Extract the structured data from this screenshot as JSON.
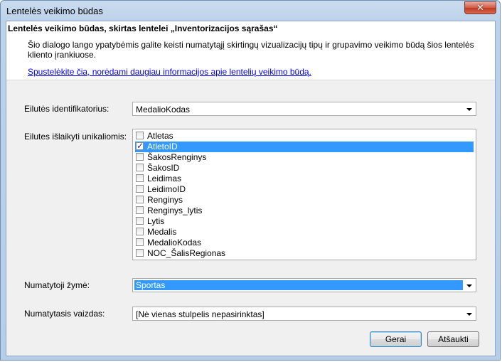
{
  "window": {
    "title": "Lentelės veikimo būdas",
    "close_symbol": "✕"
  },
  "info": {
    "heading": "Lentelės veikimo būdas, skirtas lentelei „Inventorizacijos sąrašas“",
    "description": "Šio dialogo lango ypatybėmis galite keisti numatytąjį skirtingų vizualizacijų tipų ir grupavimo veikimo būdą šios lentelės kliento įrankiuose.",
    "link": "Spustelėkite čia, norėdami daugiau informacijos apie lentelių veikimo būdą."
  },
  "row_identifier": {
    "label": "Eilutės identifikatorius:",
    "value": "MedalioKodas"
  },
  "unique_rows": {
    "label": "Eilutes išlaikyti unikaliomis:",
    "items": [
      {
        "label": "Atletas",
        "checked": false
      },
      {
        "label": "AtletoID",
        "checked": true
      },
      {
        "label": "ŠakosRenginys",
        "checked": false
      },
      {
        "label": "ŠakosID",
        "checked": false
      },
      {
        "label": "Leidimas",
        "checked": false
      },
      {
        "label": "LeidimoID",
        "checked": false
      },
      {
        "label": "Renginys",
        "checked": false
      },
      {
        "label": "Renginys_lytis",
        "checked": false
      },
      {
        "label": "Lytis",
        "checked": false
      },
      {
        "label": "Medalis",
        "checked": false
      },
      {
        "label": "MedalioKodas",
        "checked": false
      },
      {
        "label": "NOC_ŠalisRegionas",
        "checked": false
      }
    ],
    "selected_index": 1
  },
  "default_label": {
    "label": "Numatytoji žymė:",
    "value": "Sportas"
  },
  "default_image": {
    "label": "Numatytasis vaizdas:",
    "value": "[Nė vienas stulpelis nepasirinktas]"
  },
  "buttons": {
    "ok": "Gerai",
    "cancel": "Atšaukti"
  }
}
